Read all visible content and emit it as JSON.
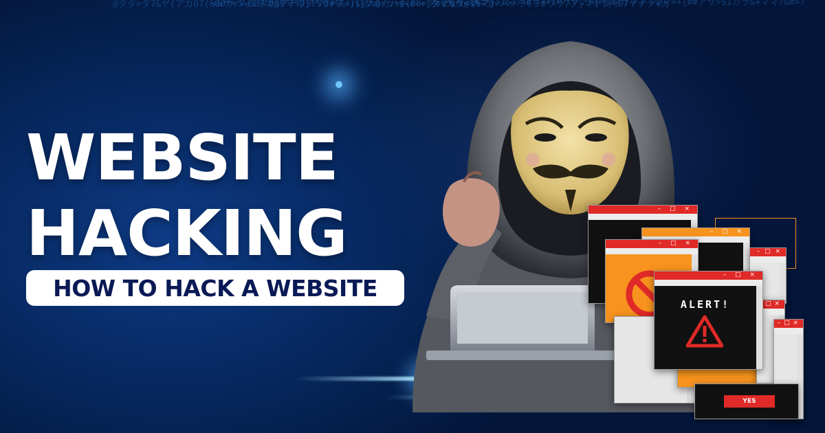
{
  "headline": {
    "line1": "WEBSITE",
    "line2": "HACKING",
    "subtitle": "HOW TO HACK A WEBSITE"
  },
  "popups": {
    "alert_label": "ALERT!",
    "yes_label": "YES",
    "window_controls": "– □ ×"
  },
  "colors": {
    "background_dark": "#03163a",
    "background_mid": "#0e3b86",
    "code_blue": "#2f7fd6",
    "headline_white": "#ffffff",
    "subtitle_text": "#0a1a55",
    "popup_red": "#e02a28",
    "popup_orange": "#f7931e",
    "popup_black": "#111111"
  },
  "icons": {
    "hacker": "hooded-hacker-with-guy-fawkes-mask-icon",
    "laptop": "laptop-icon",
    "prohibited": "prohibited-sign-icon",
    "warning": "warning-triangle-icon"
  }
}
